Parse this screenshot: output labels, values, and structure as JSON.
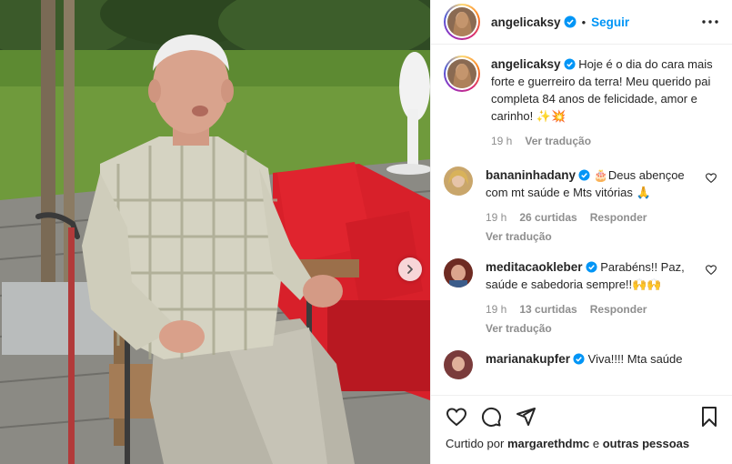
{
  "header": {
    "username": "angelicaksy",
    "separator": "•",
    "follow_label": "Seguir"
  },
  "caption": {
    "username": "angelicaksy",
    "text": "Hoje é o dia do cara mais forte e guerreiro da terra! Meu querido pai completa 84 anos de felicidade, amor e carinho! ✨💥",
    "time": "19 h",
    "translate_label": "Ver tradução"
  },
  "comments": [
    {
      "username": "bananinhadany",
      "text": "🎂Deus abençoe com mt saúde e Mts vitórias 🙏",
      "time": "19 h",
      "likes": "26 curtidas",
      "reply_label": "Responder",
      "translate_label": "Ver tradução",
      "avatar_color": "#c9a66b"
    },
    {
      "username": "meditacaokleber",
      "text": "Parabéns!! Paz, saúde e sabedoria sempre!!🙌🙌",
      "time": "19 h",
      "likes": "13 curtidas",
      "reply_label": "Responder",
      "translate_label": "Ver tradução",
      "avatar_color": "#8a3b2e"
    },
    {
      "username": "marianakupfer",
      "text": "Viva!!!! Mta saúde",
      "avatar_color": "#7a3b3b"
    }
  ],
  "footer": {
    "liked_by_prefix": "Curtido por",
    "liked_by_user": "margarethdmc",
    "liked_by_conj": "e",
    "liked_by_others": "outras pessoas"
  },
  "icons": {
    "like": "heart-icon",
    "comment": "comment-icon",
    "share": "send-icon",
    "save": "bookmark-icon",
    "more": "more-options-icon",
    "verified": "verified-badge-icon",
    "next": "chevron-right-icon"
  },
  "colors": {
    "accent": "#0095f6",
    "verified": "#0095f6",
    "muted": "#8e8e8e"
  }
}
